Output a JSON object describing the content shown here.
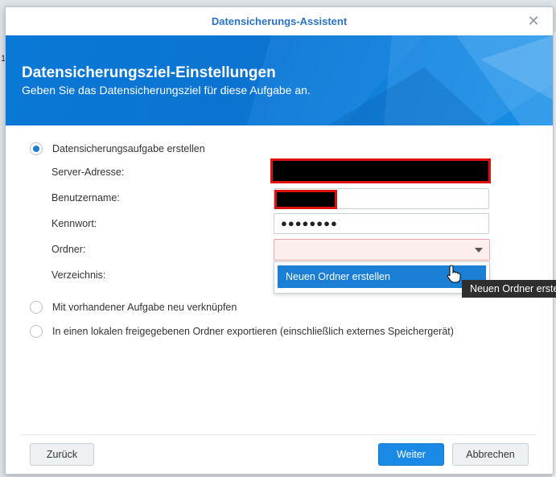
{
  "window": {
    "title": "Datensicherungs-Assistent"
  },
  "banner": {
    "heading": "Datensicherungsziel-Einstellungen",
    "subtitle": "Geben Sie das Datensicherungsziel für diese Aufgabe an."
  },
  "options": {
    "create_task": "Datensicherungsaufgabe erstellen",
    "relink_task": "Mit vorhandener Aufgabe neu verknüpfen",
    "export_local": "In einen lokalen freigegebenen Ordner exportieren (einschließlich externes Speichergerät)"
  },
  "form": {
    "server_label": "Server-Adresse:",
    "user_label": "Benutzername:",
    "password_label": "Kennwort:",
    "password_value": "●●●●●●●●",
    "folder_label": "Ordner:",
    "directory_label": "Verzeichnis:"
  },
  "dropdown": {
    "options": [
      "Neuen Ordner erstellen"
    ]
  },
  "tooltip": {
    "text": "Neuen Ordner erstellen"
  },
  "buttons": {
    "back": "Zurück",
    "next": "Weiter",
    "cancel": "Abbrechen"
  },
  "colors": {
    "accent": "#1a7fd5",
    "banner": "#0b74d1",
    "title_text": "#2b73c2",
    "error_border": "#e01010"
  }
}
